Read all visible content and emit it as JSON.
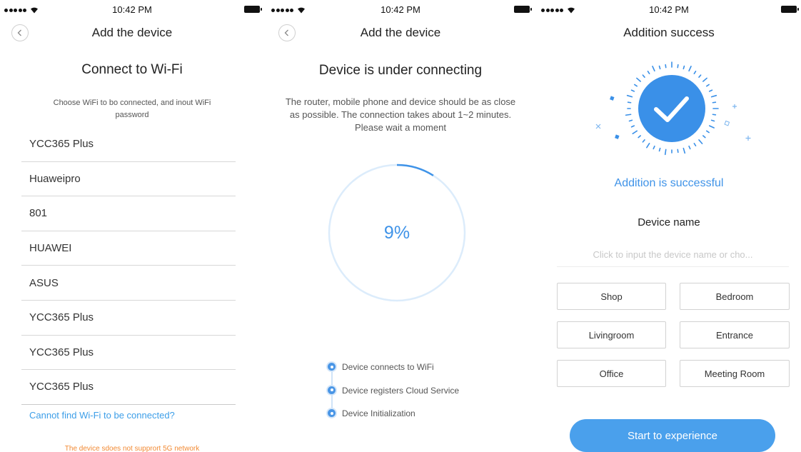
{
  "status_bar": {
    "time": "10:42 PM"
  },
  "screen1": {
    "nav_title": "Add the device",
    "heading": "Connect to Wi-Fi",
    "subtitle": "Choose WiFi to bo connected, and inout WiFi password",
    "networks": [
      "YCC365 Plus",
      "Huaweipro",
      "801",
      "HUAWEI",
      "ASUS",
      "YCC365 Plus",
      "YCC365 Plus",
      "YCC365 Plus"
    ],
    "cannot_find": "Cannot find Wi-Fi to be connected?",
    "warning": "The device sdoes not supprort 5G network"
  },
  "screen2": {
    "nav_title": "Add the device",
    "heading": "Device is under connecting",
    "description": "The router, mobile phone and device should be as close as possible. The connection takes about 1~2 minutes. Please wait a moment",
    "progress_text": "9%",
    "progress": 0.09,
    "steps": [
      "Device connects to WiFi",
      "Device registers Cloud Service",
      "Device Initialization"
    ]
  },
  "screen3": {
    "nav_title": "Addition success",
    "success_text": "Addition is successful",
    "device_name_label": "Device name",
    "name_placeholder": "Click to input the device name or cho...",
    "rooms": [
      "Shop",
      "Bedroom",
      "Livingroom",
      "Entrance",
      "Office",
      "Meeting Room"
    ],
    "start_label": "Start to experience"
  },
  "icons": {
    "back": "chevron-left-icon",
    "check": "checkmark-icon",
    "wifi": "wifi-icon",
    "battery": "battery-icon"
  },
  "colors": {
    "accent": "#3f93e8",
    "button": "#4aa0ec",
    "warning": "#f28a34",
    "progress_track": "#dcecfb"
  }
}
